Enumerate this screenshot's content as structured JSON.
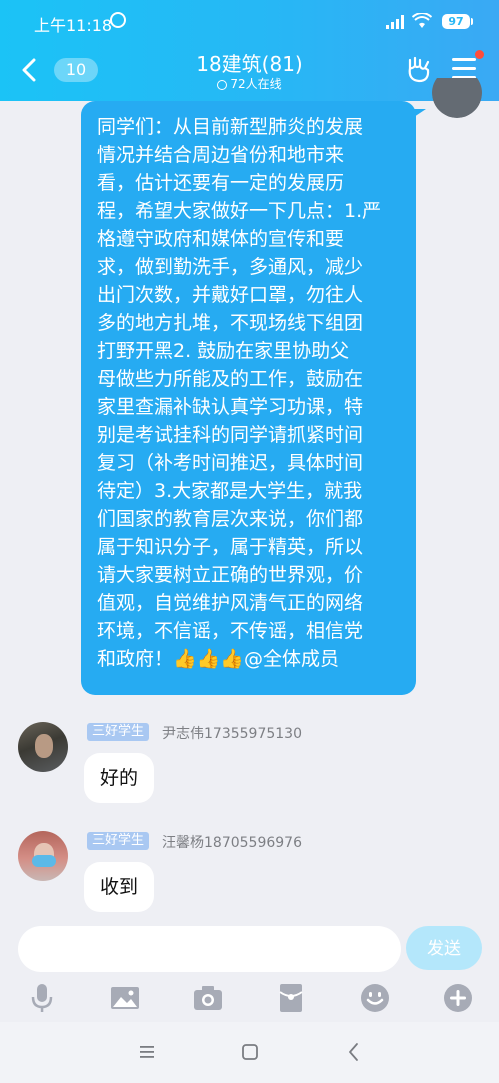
{
  "status_bar": {
    "time": "上午11:18",
    "battery": "97",
    "icons": [
      "alarm-icon",
      "signal-icon",
      "wifi-icon",
      "battery-icon"
    ]
  },
  "header": {
    "back_count": "10",
    "title": "18建筑(81)",
    "subtitle": "72人在线",
    "icons": [
      "back-chevron-icon",
      "online-icon",
      "gesture-icon",
      "menu-icon"
    ],
    "notification_dot_color": "#FF4C3B"
  },
  "messages": {
    "self": {
      "lines": [
        "同学们：从目前新型肺炎的发展",
        "情况并结合周边省份和地市来",
        "看，估计还要有一定的发展历",
        "程，希望大家做好一下几点：1.严",
        "格遵守政府和媒体的宣传和要",
        "求，做到勤洗手，多通风，减少",
        "出门次数，并戴好口罩，勿往人",
        "多的地方扎堆，不现场线下组团",
        "打野开黑2. 鼓励在家里协助父",
        "母做些力所能及的工作，鼓励在",
        "家里查漏补缺认真学习功课，特",
        "别是考试挂科的同学请抓紧时间",
        "复习（补考时间推迟，具体时间",
        "待定）3.大家都是大学生，就我",
        "们国家的教育层次来说，你们都",
        "属于知识分子，属于精英，所以",
        "请大家要树立正确的世界观，价",
        "值观，自觉维护风清气正的网络",
        "环境，不信谣，不传谣，相信党",
        "和政府！👍👍👍@全体成员"
      ]
    },
    "others": [
      {
        "tag": "三好学生",
        "name": "尹志伟17355975130",
        "text": "好的"
      },
      {
        "tag": "三好学生",
        "name": "汪馨杨18705596976",
        "text": "收到"
      }
    ]
  },
  "input_bar": {
    "placeholder": "",
    "send_label": "发送",
    "tool_icons": [
      "microphone-icon",
      "image-icon",
      "camera-icon",
      "red-packet-icon",
      "emoji-icon",
      "plus-icon"
    ]
  },
  "nav_bar": {
    "icons": [
      "recent-apps-icon",
      "home-icon",
      "back-icon"
    ]
  },
  "colors": {
    "header_blue": "#27B7F5",
    "self_bubble": "#26ABF2",
    "tag_bg": "#A9C8F2",
    "send_disabled": "#B4E7FB"
  }
}
